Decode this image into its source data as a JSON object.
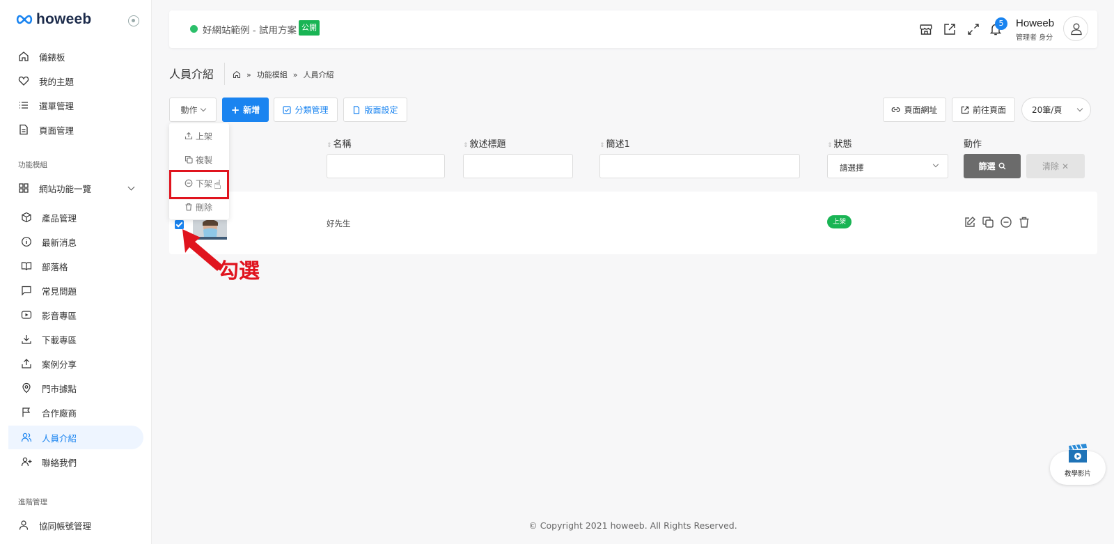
{
  "brand": {
    "logo_text": "howeeb"
  },
  "sidebar": {
    "items_top": [
      {
        "label": "儀錶板",
        "icon": "home-icon"
      },
      {
        "label": "我的主題",
        "icon": "heart-icon"
      },
      {
        "label": "選單管理",
        "icon": "list-icon"
      },
      {
        "label": "頁面管理",
        "icon": "file-icon"
      }
    ],
    "section_modules": "功能模組",
    "group": {
      "label": "網站功能一覽",
      "icon": "grid-icon"
    },
    "module_items": [
      {
        "label": "產品管理",
        "icon": "box-icon"
      },
      {
        "label": "最新消息",
        "icon": "info-icon"
      },
      {
        "label": "部落格",
        "icon": "book-icon"
      },
      {
        "label": "常見問題",
        "icon": "message-icon"
      },
      {
        "label": "影音專區",
        "icon": "video-icon"
      },
      {
        "label": "下載專區",
        "icon": "download-icon"
      },
      {
        "label": "案例分享",
        "icon": "share-icon"
      },
      {
        "label": "門市據點",
        "icon": "map-pin-icon"
      },
      {
        "label": "合作廠商",
        "icon": "flag-icon"
      },
      {
        "label": "人員介紹",
        "icon": "users-icon",
        "active": true
      },
      {
        "label": "聯絡我們",
        "icon": "user-plus-icon"
      }
    ],
    "section_advanced": "進階管理",
    "bottom_item": {
      "label": "協同帳號管理",
      "icon": "user-icon"
    }
  },
  "header": {
    "site_name": "好網站範例 - 試用方案",
    "publish_badge": "公開",
    "notification_count": "5",
    "user_name": "Howeeb",
    "user_role": "管理者 身分"
  },
  "page": {
    "title": "人員介紹",
    "breadcrumb": [
      "功能模組",
      "人員介紹"
    ]
  },
  "toolbar": {
    "action_label": "動作",
    "add_label": "新增",
    "category_label": "分類管理",
    "layout_label": "版面設定",
    "page_url_label": "頁面網址",
    "goto_page_label": "前往頁面",
    "per_page": "20筆/頁"
  },
  "action_menu": {
    "items": [
      "上架",
      "複製",
      "下架",
      "刪除"
    ],
    "highlighted": "下架"
  },
  "table": {
    "columns": [
      "名稱",
      "敘述標題",
      "簡述1",
      "狀態",
      "動作"
    ],
    "status_placeholder": "請選擇",
    "filter_label": "篩選",
    "clear_label": "清除",
    "rows": [
      {
        "checked": true,
        "name": "好先生",
        "subtitle": "",
        "summary": "",
        "status": "上架"
      }
    ]
  },
  "annotation": {
    "label": "勾選",
    "color": "#e0141e"
  },
  "footer": {
    "copyright": "© Copyright 2021 howeeb. All Rights Reserved."
  },
  "tutorial": {
    "label": "教學影片"
  },
  "colors": {
    "primary": "#1a84f0",
    "success": "#19b454",
    "annotation": "#e0141e"
  }
}
